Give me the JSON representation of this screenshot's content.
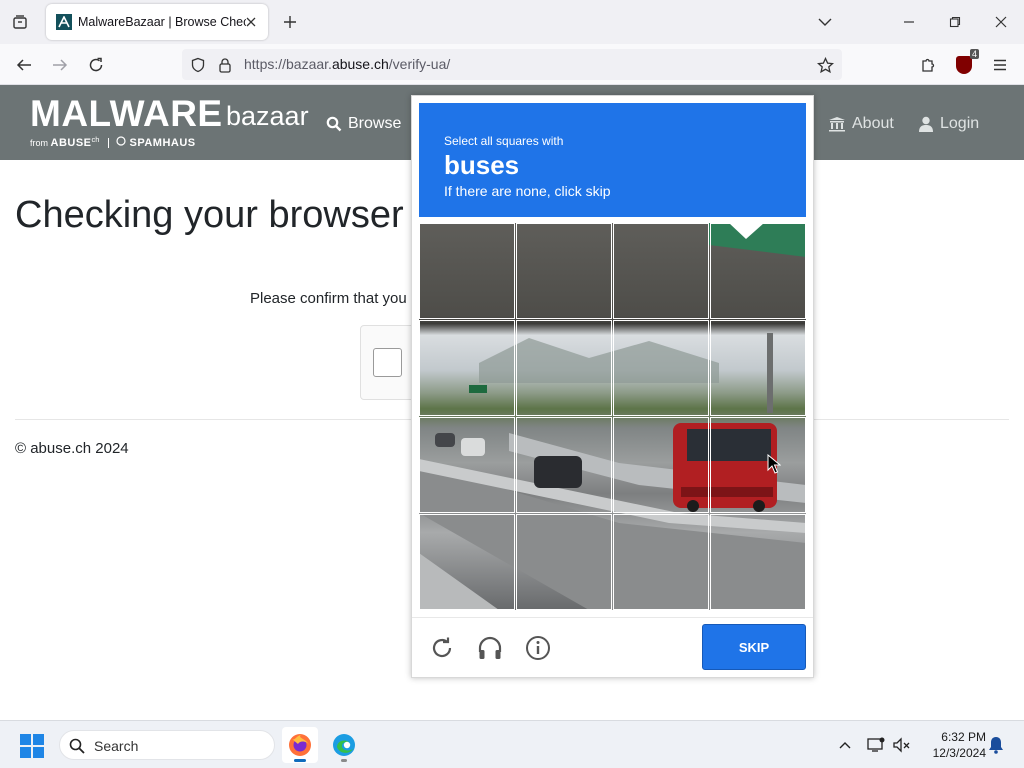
{
  "browser": {
    "tab_title": "MalwareBazaar | Browse Checkin",
    "url_prefix": "https://bazaar.",
    "url_domain": "abuse.ch",
    "url_path": "/verify-ua/",
    "ublock_badge": "4"
  },
  "site": {
    "logo_main": "MALWARE",
    "logo_sub": "bazaar",
    "logo_from_prefix": "from",
    "logo_from_brand": "ABUSE",
    "logo_from_sup": "ch",
    "logo_partner": "SPAMHAUS",
    "nav": {
      "browse": "Browse",
      "about": "About",
      "login": "Login"
    },
    "page_title": "Checking your browser",
    "confirm_text": "Please confirm that you",
    "copyright": "© abuse.ch 2024"
  },
  "challenge": {
    "line1": "Select all squares with",
    "target": "buses",
    "line3": "If there are none, click skip",
    "skip_label": "SKIP",
    "grid_size": 4
  },
  "taskbar": {
    "search_label": "Search",
    "time": "6:32 PM",
    "date": "12/3/2024"
  },
  "colors": {
    "accent": "#1f74e8",
    "header_bg": "#6c7475",
    "bus_red": "#b11f22"
  }
}
